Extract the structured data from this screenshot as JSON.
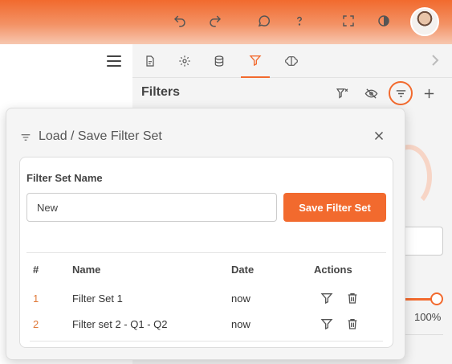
{
  "topbar": {
    "icons": [
      "undo-icon",
      "redo-icon",
      "chat-icon",
      "help-icon",
      "fullscreen-icon",
      "theme-icon"
    ],
    "avatar": "user-avatar"
  },
  "tabs": {
    "items": [
      "document-icon",
      "gear-icon",
      "database-icon",
      "filter-icon",
      "brain-icon"
    ],
    "active": "filter-icon"
  },
  "filters_panel": {
    "title": "Filters",
    "background_value": "100%"
  },
  "modal": {
    "title": "Load / Save Filter Set",
    "filter_set_name_label": "Filter Set Name",
    "filter_set_name_value": "New",
    "save_button": "Save Filter Set",
    "table": {
      "headers": [
        "#",
        "Name",
        "Date",
        "Actions"
      ],
      "rows": [
        {
          "num": "1",
          "name": "Filter Set 1",
          "date": "now"
        },
        {
          "num": "2",
          "name": "Filter set 2 - Q1 - Q2",
          "date": "now"
        }
      ]
    }
  },
  "colors": {
    "accent": "#f26a2e",
    "number": "#e07a3a"
  }
}
